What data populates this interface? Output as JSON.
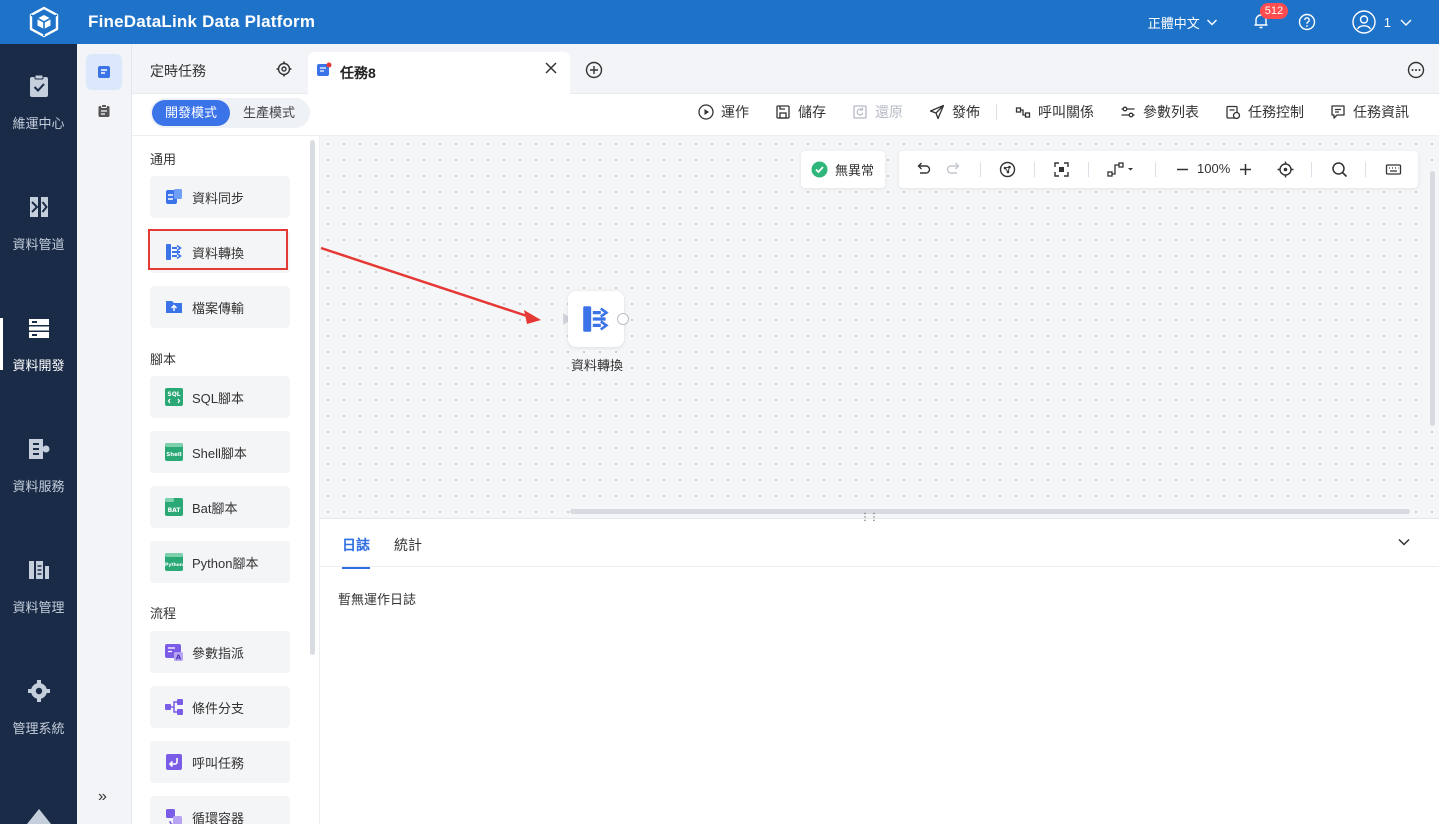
{
  "app": {
    "title": "FineDataLink Data Platform"
  },
  "header": {
    "language": "正體中文",
    "notifications_count": "512",
    "user": "1",
    "icons": [
      "logo-icon",
      "bell-icon",
      "help-icon",
      "user-icon",
      "chevron-down-icon"
    ]
  },
  "left_nav": {
    "items": [
      {
        "label": "維運中心",
        "icon": "clipboard-check-icon"
      },
      {
        "label": "資料管道",
        "icon": "pipeline-icon"
      },
      {
        "label": "資料開發",
        "icon": "dev-icon",
        "active": true
      },
      {
        "label": "資料服務",
        "icon": "service-icon"
      },
      {
        "label": "資料管理",
        "icon": "data-manage-icon"
      },
      {
        "label": "管理系統",
        "icon": "gear-icon"
      }
    ],
    "expand_label": "»"
  },
  "tabs": {
    "scheduled": "定時任務",
    "current": "任務8"
  },
  "mode": {
    "dev": "開發模式",
    "prod": "生產模式",
    "active": "dev"
  },
  "toolbar": {
    "run": "運作",
    "save": "儲存",
    "restore": "還原",
    "publish": "發佈",
    "call_relation": "呼叫關係",
    "params": "參數列表",
    "task_control": "任務控制",
    "task_info": "任務資訊"
  },
  "node_panel": {
    "sections": [
      {
        "title": "通用",
        "items": [
          "資料同步",
          "資料轉換",
          "檔案傳輸"
        ]
      },
      {
        "title": "腳本",
        "items": [
          "SQL腳本",
          "Shell腳本",
          "Bat腳本",
          "Python腳本"
        ]
      },
      {
        "title": "流程",
        "items": [
          "參數指派",
          "條件分支",
          "呼叫任務",
          "循環容器"
        ]
      }
    ],
    "highlighted": "資料轉換"
  },
  "canvas": {
    "status": "無異常",
    "zoom": "100%",
    "node_label": "資料轉換"
  },
  "log": {
    "tabs": [
      "日誌",
      "統計"
    ],
    "active_tab": "日誌",
    "empty_text": "暫無運作日誌"
  },
  "colors": {
    "topbar": "#1e73c9",
    "leftnav": "#1a2b47",
    "accent": "#3b73e8",
    "highlight_box": "#e53935",
    "ok_green": "#2fb67a"
  }
}
